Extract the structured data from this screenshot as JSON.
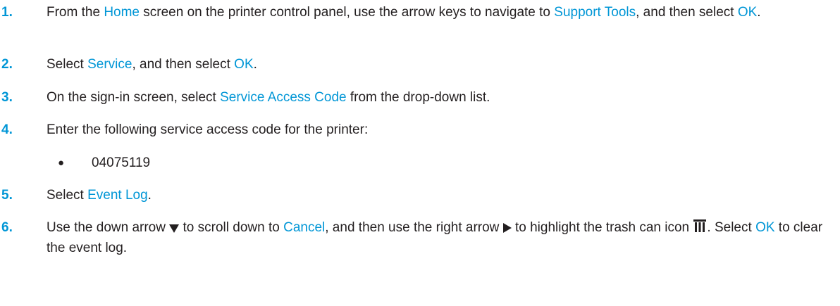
{
  "steps": [
    {
      "number": "1.",
      "parts": [
        "From the ",
        "Home",
        " screen on the printer control panel, use the arrow keys to navigate to ",
        "Support Tools",
        ", and then select ",
        "OK",
        "."
      ]
    },
    {
      "number": "2.",
      "parts": [
        "Select ",
        "Service",
        ", and then select ",
        "OK",
        "."
      ]
    },
    {
      "number": "3.",
      "parts": [
        "On the sign-in screen, select ",
        "Service Access Code",
        " from the drop-down list."
      ]
    },
    {
      "number": "4.",
      "text": "Enter the following service access code for the printer:",
      "bullet_symbol": "●",
      "bullet_value": "04075119"
    },
    {
      "number": "5.",
      "parts": [
        "Select ",
        "Event Log",
        "."
      ]
    },
    {
      "number": "6.",
      "parts": [
        "Use the down arrow ",
        " to scroll down to ",
        "Cancel",
        ", and then use the right arrow ",
        " to highlight the trash can icon ",
        ". Select ",
        "OK",
        " to clear the event log."
      ]
    }
  ],
  "colors": {
    "accent": "#0096d6",
    "text": "#231f20"
  },
  "icons": [
    "down-arrow-icon",
    "right-arrow-icon",
    "trash-can-icon"
  ]
}
